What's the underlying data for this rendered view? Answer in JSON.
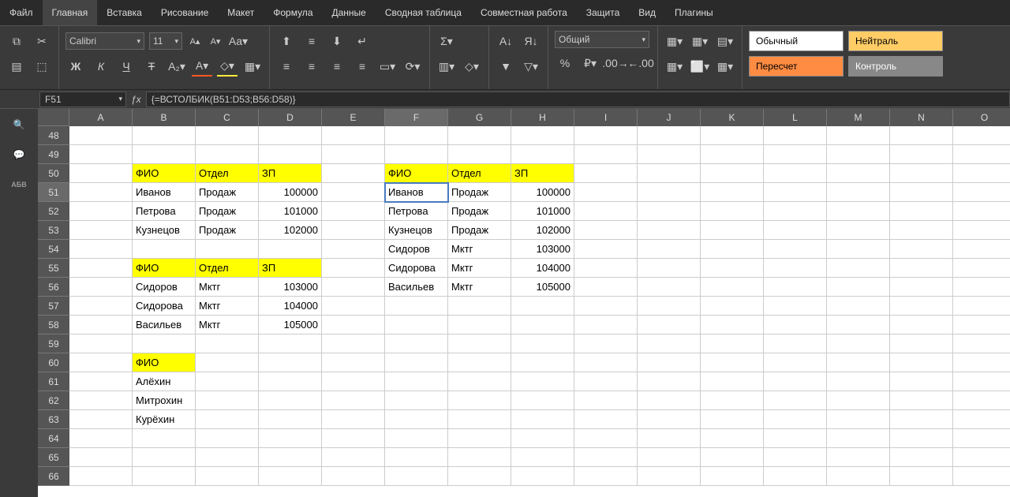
{
  "menu": [
    "Файл",
    "Главная",
    "Вставка",
    "Рисование",
    "Макет",
    "Формула",
    "Данные",
    "Сводная таблица",
    "Совместная работа",
    "Защита",
    "Вид",
    "Плагины"
  ],
  "active_menu": 1,
  "font": {
    "name": "Calibri",
    "size": "11"
  },
  "num_format": "Общий",
  "styles": {
    "normal": "Обычный",
    "neutral": "Нейтраль",
    "calc": "Пересчет",
    "check": "Контроль"
  },
  "name_box": "F51",
  "formula": "{=ВСТОЛБИК(B51:D53;B56:D58)}",
  "columns": [
    "A",
    "B",
    "C",
    "D",
    "E",
    "F",
    "G",
    "H",
    "I",
    "J",
    "K",
    "L",
    "M",
    "N",
    "O"
  ],
  "selected_col": "F",
  "rows_start": 48,
  "rows_end": 66,
  "selected_row": 51,
  "active_cell": "F51",
  "cells": {
    "B50": {
      "v": "ФИО",
      "hl": true
    },
    "C50": {
      "v": "Отдел",
      "hl": true
    },
    "D50": {
      "v": "ЗП",
      "hl": true
    },
    "B51": {
      "v": "Иванов"
    },
    "C51": {
      "v": "Продаж"
    },
    "D51": {
      "v": "100000",
      "num": true
    },
    "B52": {
      "v": "Петрова"
    },
    "C52": {
      "v": "Продаж"
    },
    "D52": {
      "v": "101000",
      "num": true
    },
    "B53": {
      "v": "Кузнецов"
    },
    "C53": {
      "v": "Продаж"
    },
    "D53": {
      "v": "102000",
      "num": true
    },
    "B55": {
      "v": "ФИО",
      "hl": true
    },
    "C55": {
      "v": "Отдел",
      "hl": true
    },
    "D55": {
      "v": "ЗП",
      "hl": true
    },
    "B56": {
      "v": "Сидоров"
    },
    "C56": {
      "v": "Мктг"
    },
    "D56": {
      "v": "103000",
      "num": true
    },
    "B57": {
      "v": "Сидорова"
    },
    "C57": {
      "v": "Мктг"
    },
    "D57": {
      "v": "104000",
      "num": true
    },
    "B58": {
      "v": "Васильев"
    },
    "C58": {
      "v": "Мктг"
    },
    "D58": {
      "v": "105000",
      "num": true
    },
    "B60": {
      "v": "ФИО",
      "hl": true
    },
    "B61": {
      "v": "Алёхин"
    },
    "B62": {
      "v": "Митрохин"
    },
    "B63": {
      "v": "Курёхин"
    },
    "F50": {
      "v": "ФИО",
      "hl": true
    },
    "G50": {
      "v": "Отдел",
      "hl": true
    },
    "H50": {
      "v": "ЗП",
      "hl": true
    },
    "F51": {
      "v": "Иванов"
    },
    "G51": {
      "v": "Продаж"
    },
    "H51": {
      "v": "100000",
      "num": true
    },
    "F52": {
      "v": "Петрова"
    },
    "G52": {
      "v": "Продаж"
    },
    "H52": {
      "v": "101000",
      "num": true
    },
    "F53": {
      "v": "Кузнецов"
    },
    "G53": {
      "v": "Продаж"
    },
    "H53": {
      "v": "102000",
      "num": true
    },
    "F54": {
      "v": "Сидоров"
    },
    "G54": {
      "v": "Мктг"
    },
    "H54": {
      "v": "103000",
      "num": true
    },
    "F55": {
      "v": "Сидорова"
    },
    "G55": {
      "v": "Мктг"
    },
    "H55": {
      "v": "104000",
      "num": true
    },
    "F56": {
      "v": "Васильев"
    },
    "G56": {
      "v": "Мктг"
    },
    "H56": {
      "v": "105000",
      "num": true
    }
  }
}
